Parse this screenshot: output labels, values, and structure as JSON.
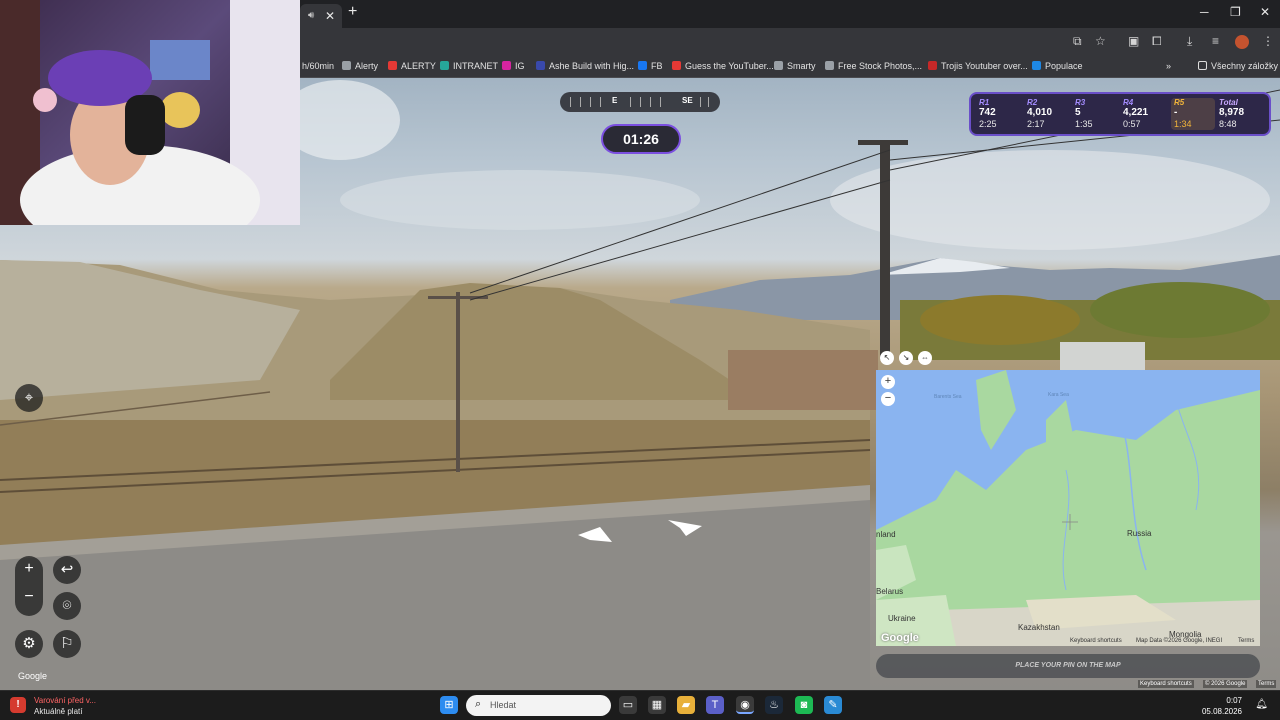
{
  "browser": {
    "tab_mute_icon": "speaker-icon",
    "tab_close": "✕",
    "new_tab": "+",
    "bookmarks": [
      {
        "label": "h/60min",
        "color": "#35363a"
      },
      {
        "label": "Alerty",
        "color": "#9aa0a6"
      },
      {
        "label": "ALERTY",
        "color": "#e53935"
      },
      {
        "label": "INTRANET",
        "color": "#26a69a"
      },
      {
        "label": "IG",
        "color": "#d6249f"
      },
      {
        "label": "Ashe Build with Hig...",
        "color": "#3949ab"
      },
      {
        "label": "FB",
        "color": "#1877f2"
      },
      {
        "label": "Guess the YouTuber...",
        "color": "#e53935"
      },
      {
        "label": "Smarty",
        "color": "#9aa0a6"
      },
      {
        "label": "Free Stock Photos,...",
        "color": "#9aa0a6"
      },
      {
        "label": "Trojis Youtuber over...",
        "color": "#c62828"
      },
      {
        "label": "Populace",
        "color": "#1e88e5"
      }
    ],
    "bookmarks_overflow": "»",
    "all_bookmarks": "Všechny záložky"
  },
  "game": {
    "compass": {
      "left_label": "E",
      "right_label": "SE"
    },
    "timer": "01:26",
    "rounds": [
      {
        "label": "R1",
        "score": "742",
        "time": "2:25"
      },
      {
        "label": "R2",
        "score": "4,010",
        "time": "2:17"
      },
      {
        "label": "R3",
        "score": "5",
        "time": "1:35"
      },
      {
        "label": "R4",
        "score": "4,221",
        "time": "0:57"
      },
      {
        "label": "R5",
        "score": "-",
        "time": "1:34"
      }
    ],
    "total": {
      "label": "Total",
      "score": "8,978",
      "time": "8:48"
    },
    "google_watermark": "Google",
    "pin_button": "PLACE YOUR PIN ON THE MAP"
  },
  "map": {
    "labels": {
      "barents_sea": "Barents Sea",
      "kara_sea": "Kara Sea",
      "russia": "Russia",
      "finland": "nland",
      "belarus": "Belarus",
      "ukraine": "Ukraine",
      "kazakhstan": "Kazakhstan",
      "mongolia": "Mongolia"
    },
    "google": "Google",
    "attribution": {
      "shortcuts": "Keyboard shortcuts",
      "data": "Map Data ©2026 Google, INEGI",
      "terms": "Terms"
    }
  },
  "page_footer": {
    "shortcuts": "Keyboard shortcuts",
    "copyright": "© 2026 Google",
    "terms": "Terms"
  },
  "taskbar": {
    "warning_title": "Varování před v...",
    "warning_sub": "Aktuálně platí",
    "search_placeholder": "Hledat",
    "time": "0:07",
    "date": "05.08.2026"
  }
}
